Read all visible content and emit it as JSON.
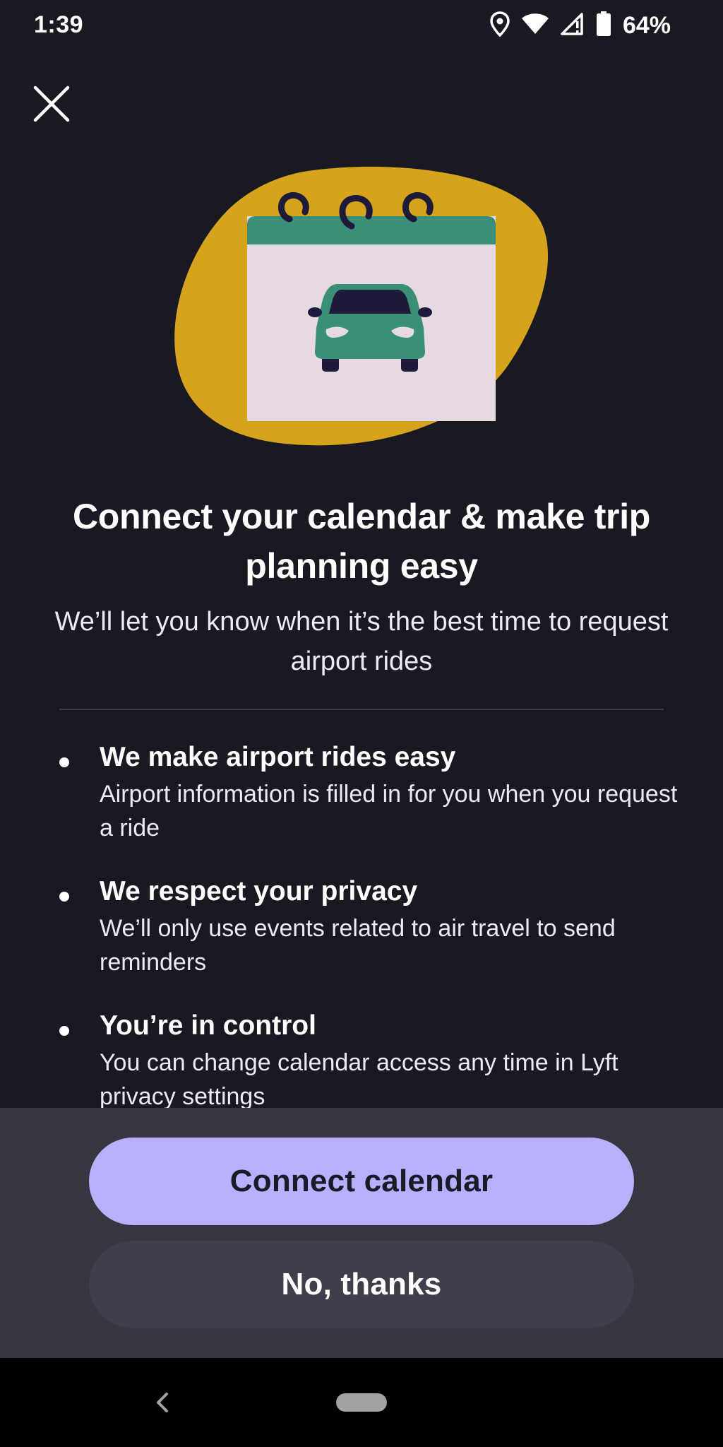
{
  "status_bar": {
    "time": "1:39",
    "battery_percent": "64%",
    "icons": [
      "location-icon",
      "wifi-icon",
      "cell-signal-icon",
      "battery-icon"
    ]
  },
  "close_icon": "close-icon",
  "illustration": {
    "description_icons": [
      "calendar-icon",
      "car-icon"
    ],
    "colors": {
      "blob": "#d6a31c",
      "calendar_header": "#3a8f78",
      "calendar_page": "#e6d9e1",
      "car": "#3a8f78",
      "rings": "#1e1b3a"
    }
  },
  "headline": "Connect your calendar & make trip planning easy",
  "subhead": "We’ll let you know when it’s the best time to request airport rides",
  "benefits": [
    {
      "title": "We make airport rides easy",
      "description": "Airport information is filled in for you when you request a ride"
    },
    {
      "title": "We respect your privacy",
      "description": "We’ll only use events related to air travel to send reminders"
    },
    {
      "title": "You’re in control",
      "description": "You can change calendar access any time in Lyft privacy settings"
    }
  ],
  "actions": {
    "primary_label": "Connect calendar",
    "secondary_label": "No, thanks"
  },
  "colors": {
    "background": "#191a21",
    "sheet": "#363640",
    "primary_button": "#b8b0fc",
    "secondary_button": "#3f3e4a"
  },
  "nav_bar": {
    "icons": [
      "back-icon",
      "home-pill-icon"
    ]
  }
}
